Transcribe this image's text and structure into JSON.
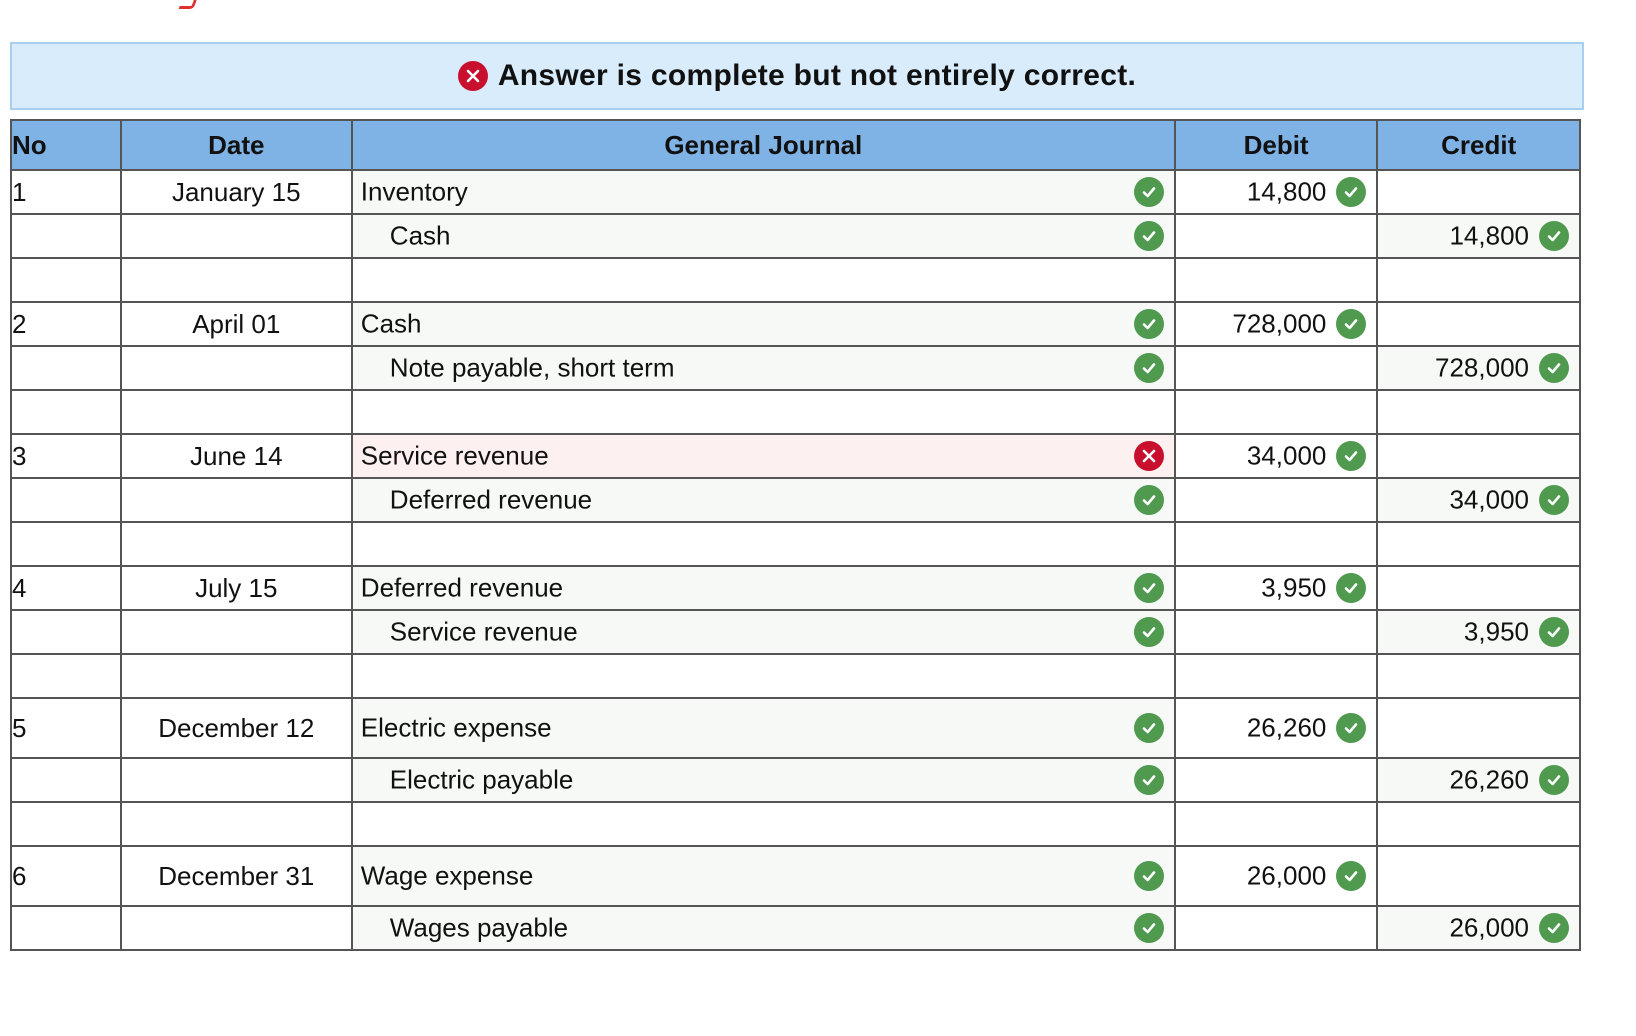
{
  "banner": {
    "text": "Answer is complete but not entirely correct.",
    "icon": "x-circle-icon"
  },
  "columns": {
    "no": "No",
    "date": "Date",
    "journal": "General Journal",
    "debit": "Debit",
    "credit": "Credit"
  },
  "colors": {
    "correct": "#4f9a4f",
    "incorrect": "#c8102e",
    "header_bg": "#7fb2e5",
    "banner_bg": "#d9ecfb"
  },
  "entries": [
    {
      "no": "1",
      "date": "January 15",
      "debit_line": {
        "account": "Inventory",
        "amount": "14,800",
        "account_status": "correct",
        "amount_status": "correct"
      },
      "credit_line": {
        "account": "Cash",
        "amount": "14,800",
        "account_status": "correct",
        "amount_status": "correct"
      }
    },
    {
      "no": "2",
      "date": "April 01",
      "debit_line": {
        "account": "Cash",
        "amount": "728,000",
        "account_status": "correct",
        "amount_status": "correct"
      },
      "credit_line": {
        "account": "Note payable, short term",
        "amount": "728,000",
        "account_status": "correct",
        "amount_status": "correct"
      }
    },
    {
      "no": "3",
      "date": "June 14",
      "debit_line": {
        "account": "Service revenue",
        "amount": "34,000",
        "account_status": "incorrect",
        "amount_status": "correct"
      },
      "credit_line": {
        "account": "Deferred revenue",
        "amount": "34,000",
        "account_status": "correct",
        "amount_status": "correct"
      }
    },
    {
      "no": "4",
      "date": "July 15",
      "debit_line": {
        "account": "Deferred revenue",
        "amount": "3,950",
        "account_status": "correct",
        "amount_status": "correct"
      },
      "credit_line": {
        "account": "Service revenue",
        "amount": "3,950",
        "account_status": "correct",
        "amount_status": "correct"
      }
    },
    {
      "no": "5",
      "date": "December 12",
      "debit_line": {
        "account": "Electric expense",
        "amount": "26,260",
        "account_status": "correct",
        "amount_status": "correct"
      },
      "credit_line": {
        "account": "Electric payable",
        "amount": "26,260",
        "account_status": "correct",
        "amount_status": "correct"
      }
    },
    {
      "no": "6",
      "date": "December 31",
      "debit_line": {
        "account": "Wage expense",
        "amount": "26,000",
        "account_status": "correct",
        "amount_status": "correct"
      },
      "credit_line": {
        "account": "Wages payable",
        "amount": "26,000",
        "account_status": "correct",
        "amount_status": "correct"
      }
    }
  ]
}
